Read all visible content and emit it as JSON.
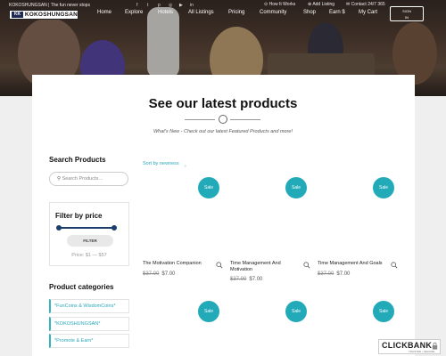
{
  "topbar": {
    "site_text": "KOKOSHUNGSAN | The fun never stops",
    "social_icons": [
      "facebook-icon",
      "twitter-icon",
      "pinterest-icon",
      "instagram-icon",
      "youtube-icon",
      "linkedin-icon"
    ],
    "links": [
      "How It Works",
      "Add Listing",
      "Contact 24/7 365"
    ]
  },
  "logo": {
    "text": "KOKOSHUNGSAN",
    "mark": "KK"
  },
  "nav": [
    "Home",
    "Explore",
    "Hotels",
    "All Listings",
    "Pricing",
    "Community",
    "Shop",
    "Earn $",
    "My Cart"
  ],
  "signin": {
    "line1": "SIGN",
    "line2": "IN"
  },
  "main": {
    "title": "See our latest products",
    "subtitle": "What's New - Check out our latest Featured Products and more!"
  },
  "sidebar": {
    "search_heading": "Search Products",
    "search_placeholder": "Search Products…",
    "filter_heading": "Filter by price",
    "filter_button": "FILTER",
    "price_text": "Price: $1 — $57",
    "categories_heading": "Product categories",
    "categories": [
      "*FunCoins & WisdomCoins*",
      "*KOKOSHUNGSAN*",
      "*Promote & Earn*"
    ]
  },
  "shop": {
    "sort_label": "Sort by newness",
    "sale_label": "Sale",
    "products": [
      {
        "name": "The Motivation Companion",
        "old_price": "$37.00",
        "price": "$7.00"
      },
      {
        "name": "Time Management And Motivation",
        "old_price": "$37.00",
        "price": "$7.00"
      },
      {
        "name": "Time Management And Goals",
        "old_price": "$37.00",
        "price": "$7.00"
      }
    ]
  },
  "badge": {
    "title": "CLICKBANK",
    "subtitle": "TRUSTED • SECURE"
  },
  "colors": {
    "accent": "#22aab9",
    "slider": "#1a3f6e"
  }
}
